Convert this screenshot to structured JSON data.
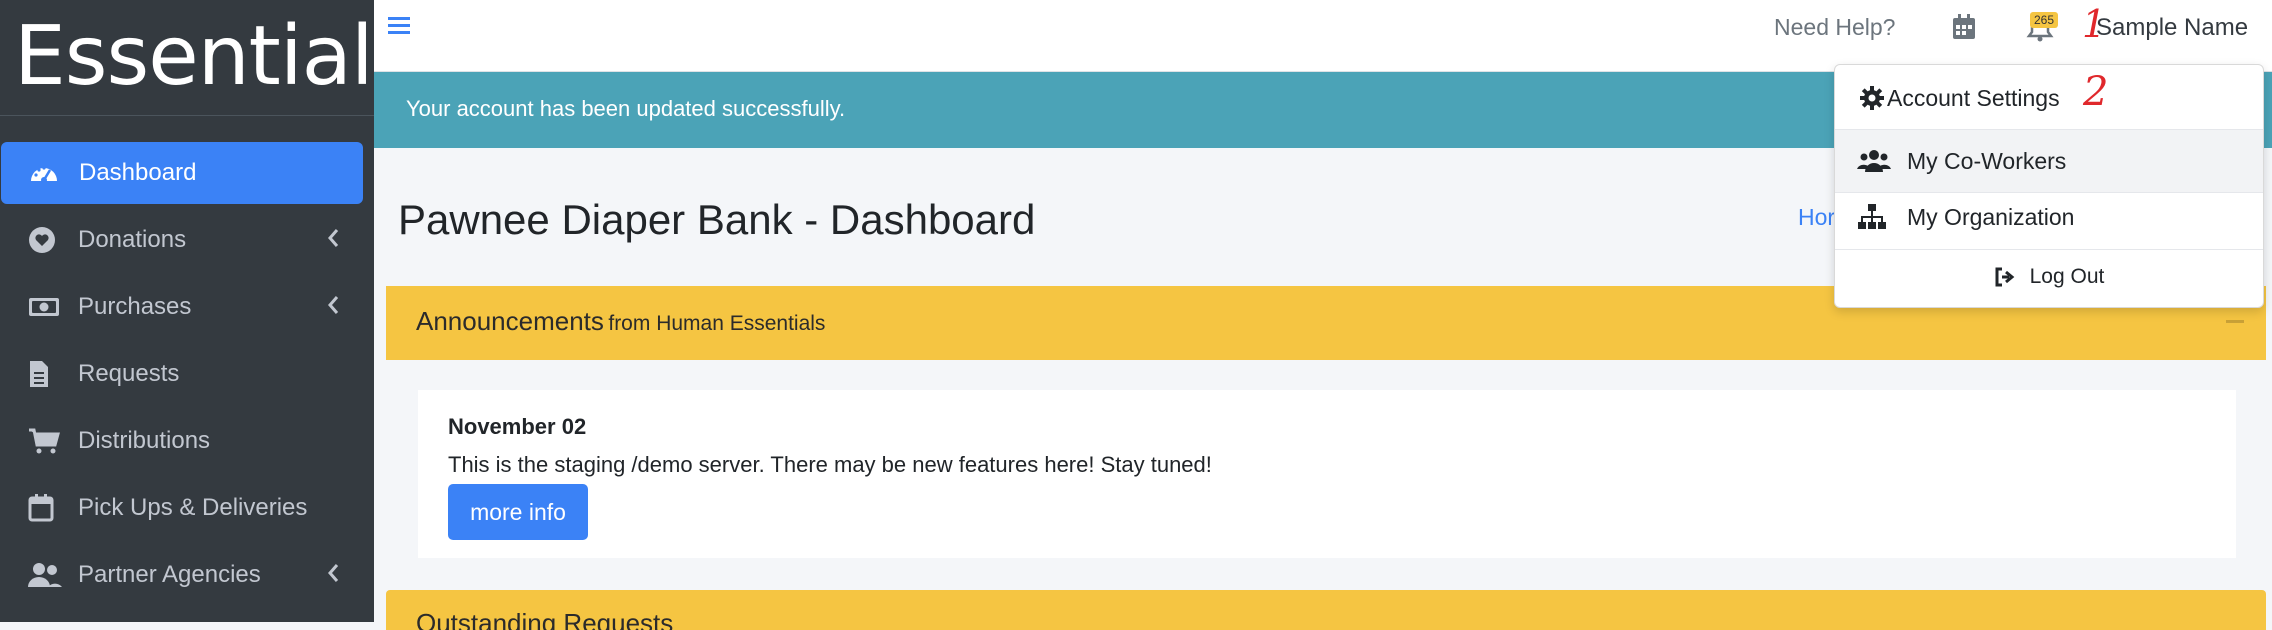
{
  "sidebar": {
    "brand": "Essentials",
    "items": [
      {
        "label": "Dashboard",
        "icon": "gauge-icon",
        "active": true,
        "caret": false
      },
      {
        "label": "Donations",
        "icon": "heart-icon",
        "active": false,
        "caret": true
      },
      {
        "label": "Purchases",
        "icon": "money-icon",
        "active": false,
        "caret": true
      },
      {
        "label": "Requests",
        "icon": "file-icon",
        "active": false,
        "caret": false
      },
      {
        "label": "Distributions",
        "icon": "cart-icon",
        "active": false,
        "caret": false
      },
      {
        "label": "Pick Ups & Deliveries",
        "icon": "calendar-icon",
        "active": false,
        "caret": false
      },
      {
        "label": "Partner Agencies",
        "icon": "users-icon",
        "active": false,
        "caret": true
      }
    ]
  },
  "topbar": {
    "help": "Need Help?",
    "notification_count": "265",
    "user_name": "Sample Name",
    "annotation_1": "1"
  },
  "alert": {
    "message": "Your account has been updated successfully."
  },
  "page": {
    "title": "Pawnee Diaper Bank - Dashboard",
    "breadcrumb": "Hor"
  },
  "announcements": {
    "title": "Announcements",
    "subtitle": "from Human Essentials",
    "date": "November 02",
    "text": "This is the staging /demo server. There may be new features here! Stay tuned!",
    "button": "more info"
  },
  "next_card": {
    "title": "Outstanding Requests"
  },
  "dropdown": {
    "account_settings": "Account Settings",
    "co_workers": "My Co-Workers",
    "organization": "My Organization",
    "logout": "Log Out",
    "annotation_2": "2"
  },
  "colors": {
    "sidebar_bg": "#343a40",
    "active_item": "#3b82f6",
    "alert_bg": "#4ba3b7",
    "card_header": "#f5c542",
    "annotation": "#e0282c"
  }
}
